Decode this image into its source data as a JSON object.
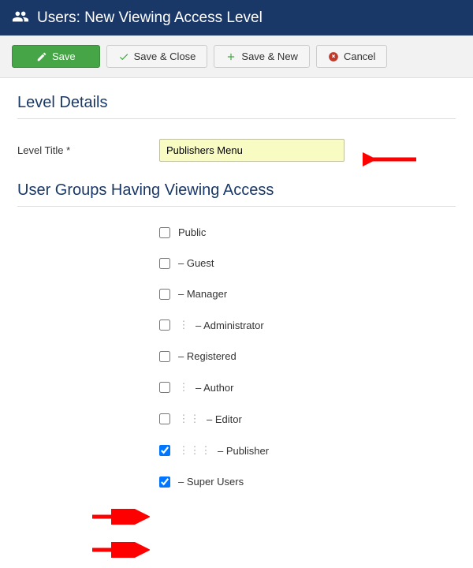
{
  "header": {
    "title": "Users: New Viewing Access Level"
  },
  "toolbar": {
    "save": "Save",
    "save_close": "Save & Close",
    "save_new": "Save & New",
    "cancel": "Cancel"
  },
  "sections": {
    "details_title": "Level Details",
    "groups_title": "User Groups Having Viewing Access"
  },
  "fields": {
    "level_title_label": "Level Title *",
    "level_title_value": "Publishers Menu"
  },
  "groups": [
    {
      "label": "Public",
      "checked": false,
      "depth": 0
    },
    {
      "label": "– Guest",
      "checked": false,
      "depth": 0
    },
    {
      "label": "– Manager",
      "checked": false,
      "depth": 0
    },
    {
      "label": "– Administrator",
      "checked": false,
      "depth": 1
    },
    {
      "label": "– Registered",
      "checked": false,
      "depth": 0
    },
    {
      "label": "– Author",
      "checked": false,
      "depth": 1
    },
    {
      "label": "– Editor",
      "checked": false,
      "depth": 2
    },
    {
      "label": "– Publisher",
      "checked": true,
      "depth": 3
    },
    {
      "label": "– Super Users",
      "checked": true,
      "depth": 0
    }
  ],
  "colors": {
    "header_bg": "#1a3867",
    "success": "#46a546",
    "arrow": "#ff0000",
    "highlight_bg": "#f8fbc2"
  }
}
